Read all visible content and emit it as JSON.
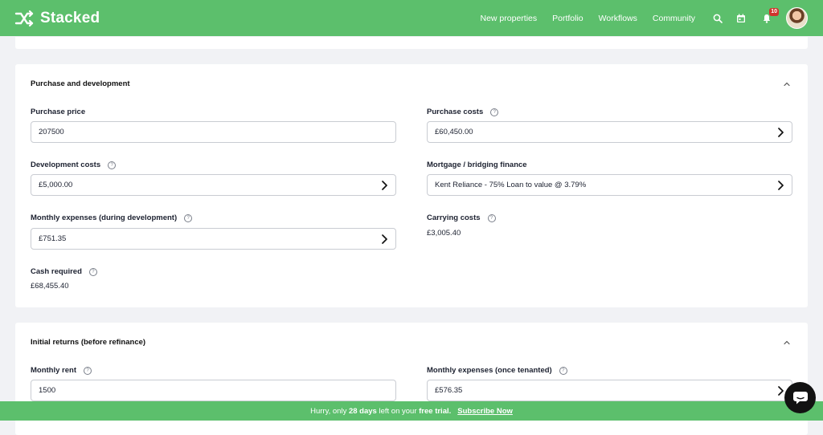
{
  "brand": {
    "name": "Stacked",
    "color": "#5cbf6c"
  },
  "nav": {
    "links": [
      "New properties",
      "Portfolio",
      "Workflows",
      "Community"
    ],
    "icons": [
      "search-icon",
      "calendar-icon",
      "bell-icon"
    ],
    "notification_count": "10"
  },
  "purchase": {
    "title": "Purchase and development",
    "purchase_price_label": "Purchase price",
    "purchase_price_value": "207500",
    "purchase_costs_label": "Purchase costs",
    "purchase_costs_value": "£60,450.00",
    "development_costs_label": "Development costs",
    "development_costs_value": "£5,000.00",
    "mortgage_label": "Mortgage / bridging finance",
    "mortgage_value": "Kent Reliance - 75% Loan to value @ 3.79%",
    "monthly_expenses_label": "Monthly expenses (during development)",
    "monthly_expenses_value": "£751.35",
    "carrying_costs_label": "Carrying costs",
    "carrying_costs_value": "£3,005.40",
    "cash_required_label": "Cash required",
    "cash_required_value": "£68,455.40"
  },
  "initial_returns": {
    "title": "Initial returns (before refinance)",
    "monthly_rent_label": "Monthly rent",
    "monthly_rent_value": "1500",
    "monthly_expenses_label": "Monthly expenses (once tenanted)",
    "monthly_expenses_value": "£576.35"
  },
  "trial_banner": {
    "text_before": "Hurry, only ",
    "days": "28 days",
    "text_after": " left on your ",
    "emphasis": "free trial.",
    "cta": "Subscribe Now"
  },
  "help_glyph": "?"
}
